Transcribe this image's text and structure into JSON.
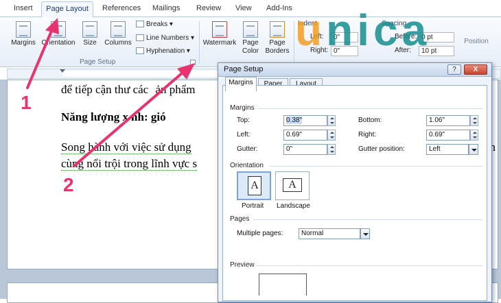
{
  "ribbon": {
    "tabs": [
      "Insert",
      "Page Layout",
      "References",
      "Mailings",
      "Review",
      "View",
      "Add-Ins"
    ],
    "active_tab": "Page Layout",
    "buttons": {
      "margins": "Margins",
      "orientation": "Orientation",
      "size": "Size",
      "columns": "Columns",
      "breaks": "Breaks",
      "line_numbers": "Line Numbers",
      "hyphenation": "Hyphenation",
      "watermark": "Watermark",
      "page_color": "Page Color",
      "page_borders": "Page Borders",
      "position": "Position"
    },
    "group_page_setup": "Page Setup",
    "indent": {
      "label": "Indent",
      "left_label": "Left:",
      "left_value": "0\"",
      "right_label": "Right:",
      "right_value": "0\""
    },
    "spacing": {
      "label": "Spacing",
      "before_label": "Before:",
      "before_value": "0 pt",
      "after_label": "After:",
      "after_value": "10 pt"
    }
  },
  "logo": {
    "text_first": "u",
    "text_rest": "nica"
  },
  "document": {
    "line1": "để tiếp cận thư các",
    "line1_end": "ản phẩm",
    "heading": "Năng lượng x",
    "heading_end": "nh: gió",
    "para_line1": "Song hành với việc sử dụng",
    "para_line1_tail": "ôn",
    "para_line2": "cùng nổi trội trong lĩnh vực s"
  },
  "callouts": {
    "one": "1",
    "two": "2"
  },
  "dialog": {
    "title": "Page Setup",
    "help_glyph": "?",
    "close_glyph": "X",
    "tabs": [
      "Margins",
      "Paper",
      "Layout"
    ],
    "active_tab": "Margins",
    "margins_section": "Margins",
    "top_label": "Top:",
    "top_value": "0.38\"",
    "bottom_label": "Bottom:",
    "bottom_value": "1.06\"",
    "left_label": "Left:",
    "left_value": "0.69\"",
    "right_label": "Right:",
    "right_value": "0.69\"",
    "gutter_label": "Gutter:",
    "gutter_value": "0\"",
    "gutter_pos_label": "Gutter position:",
    "gutter_pos_value": "Left",
    "orientation_section": "Orientation",
    "portrait": "Portrait",
    "landscape": "Landscape",
    "orient_glyph": "A",
    "pages_section": "Pages",
    "multiple_pages_label": "Multiple pages:",
    "multiple_pages_value": "Normal",
    "preview_section": "Preview"
  }
}
